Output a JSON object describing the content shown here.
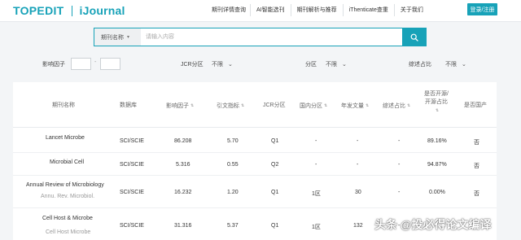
{
  "logo": {
    "brand": "TOPEDIT",
    "product": "iJournal"
  },
  "nav": {
    "items": [
      "期刊详情查询",
      "AI智能选刊",
      "期刊解析与推荐",
      "iThenticate查重",
      "关于我们"
    ],
    "login": "登录/注册"
  },
  "search": {
    "type": "期刊名称",
    "placeholder": "请输入内容"
  },
  "filters": {
    "impact_factor": "影响因子",
    "range_sep": "-",
    "jcr_label": "JCR分区",
    "jcr_value": "不限",
    "zone_label": "分区",
    "zone_value": "不限",
    "review_label": "综述占比",
    "review_value": "不限"
  },
  "table": {
    "headers": {
      "name": "期刊名称",
      "database": "数据库",
      "impact_factor": "影响因子",
      "citation_index": "引文指标",
      "jcr": "JCR分区",
      "domestic_zone": "国内分区",
      "annual_articles": "年发文量",
      "review_ratio": "综述占比",
      "open_access": [
        "是否开源/",
        "开源占比"
      ],
      "domestic": "是否国产"
    },
    "rows": [
      {
        "name": "Lancet Microbe",
        "abbr": "",
        "database": "SCI/SCIE",
        "impact_factor": "86.208",
        "citation_index": "5.70",
        "jcr": "Q1",
        "domestic_zone": "-",
        "annual_articles": "-",
        "review_ratio": "-",
        "open_access": "89.16%",
        "domestic": "否"
      },
      {
        "name": "Microbial Cell",
        "abbr": "",
        "database": "SCI/SCIE",
        "impact_factor": "5.316",
        "citation_index": "0.55",
        "jcr": "Q2",
        "domestic_zone": "-",
        "annual_articles": "-",
        "review_ratio": "-",
        "open_access": "94.87%",
        "domestic": "否"
      },
      {
        "name": "Annual Review of Microbiology",
        "abbr": "Annu. Rev. Microbiol.",
        "database": "SCI/SCIE",
        "impact_factor": "16.232",
        "citation_index": "1.20",
        "jcr": "Q1",
        "domestic_zone": "1区",
        "annual_articles": "30",
        "review_ratio": "-",
        "open_access": "0.00%",
        "domestic": "否"
      },
      {
        "name": "Cell Host & Microbe",
        "abbr": "Cell Host Microbe",
        "database": "SCI/SCIE",
        "impact_factor": "31.316",
        "citation_index": "5.37",
        "jcr": "Q1",
        "domestic_zone": "1区",
        "annual_articles": "132",
        "review_ratio": "-",
        "open_access": "",
        "domestic": ""
      }
    ]
  },
  "watermark": "头条 @投必得论文编译",
  "colors": {
    "accent": "#17a2b8",
    "background": "#f3f5f7"
  },
  "icons": [
    "search-icon",
    "chevron-down-icon",
    "sort-icon"
  ]
}
